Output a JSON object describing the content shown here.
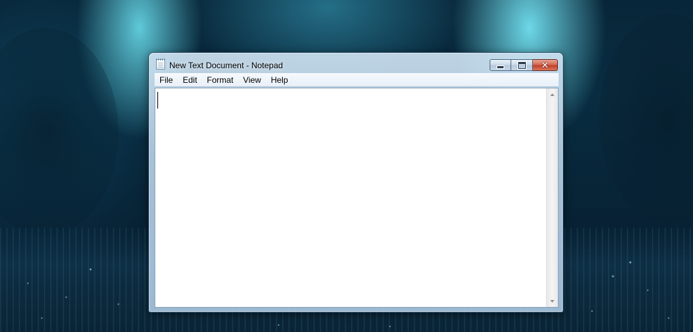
{
  "window": {
    "title": "New Text Document - Notepad",
    "app_icon": "notepad-icon",
    "controls": {
      "minimize_icon": "minimize-icon",
      "maximize_icon": "maximize-icon",
      "close_icon": "close-icon",
      "close_glyph": "✕"
    }
  },
  "menu": {
    "items": [
      {
        "label": "File"
      },
      {
        "label": "Edit"
      },
      {
        "label": "Format"
      },
      {
        "label": "View"
      },
      {
        "label": "Help"
      }
    ]
  },
  "editor": {
    "content": ""
  },
  "colors": {
    "close_button": "#c7402a",
    "titlebar_glass": "#bcd4e8",
    "desktop_glow": "#6ee6f5"
  }
}
